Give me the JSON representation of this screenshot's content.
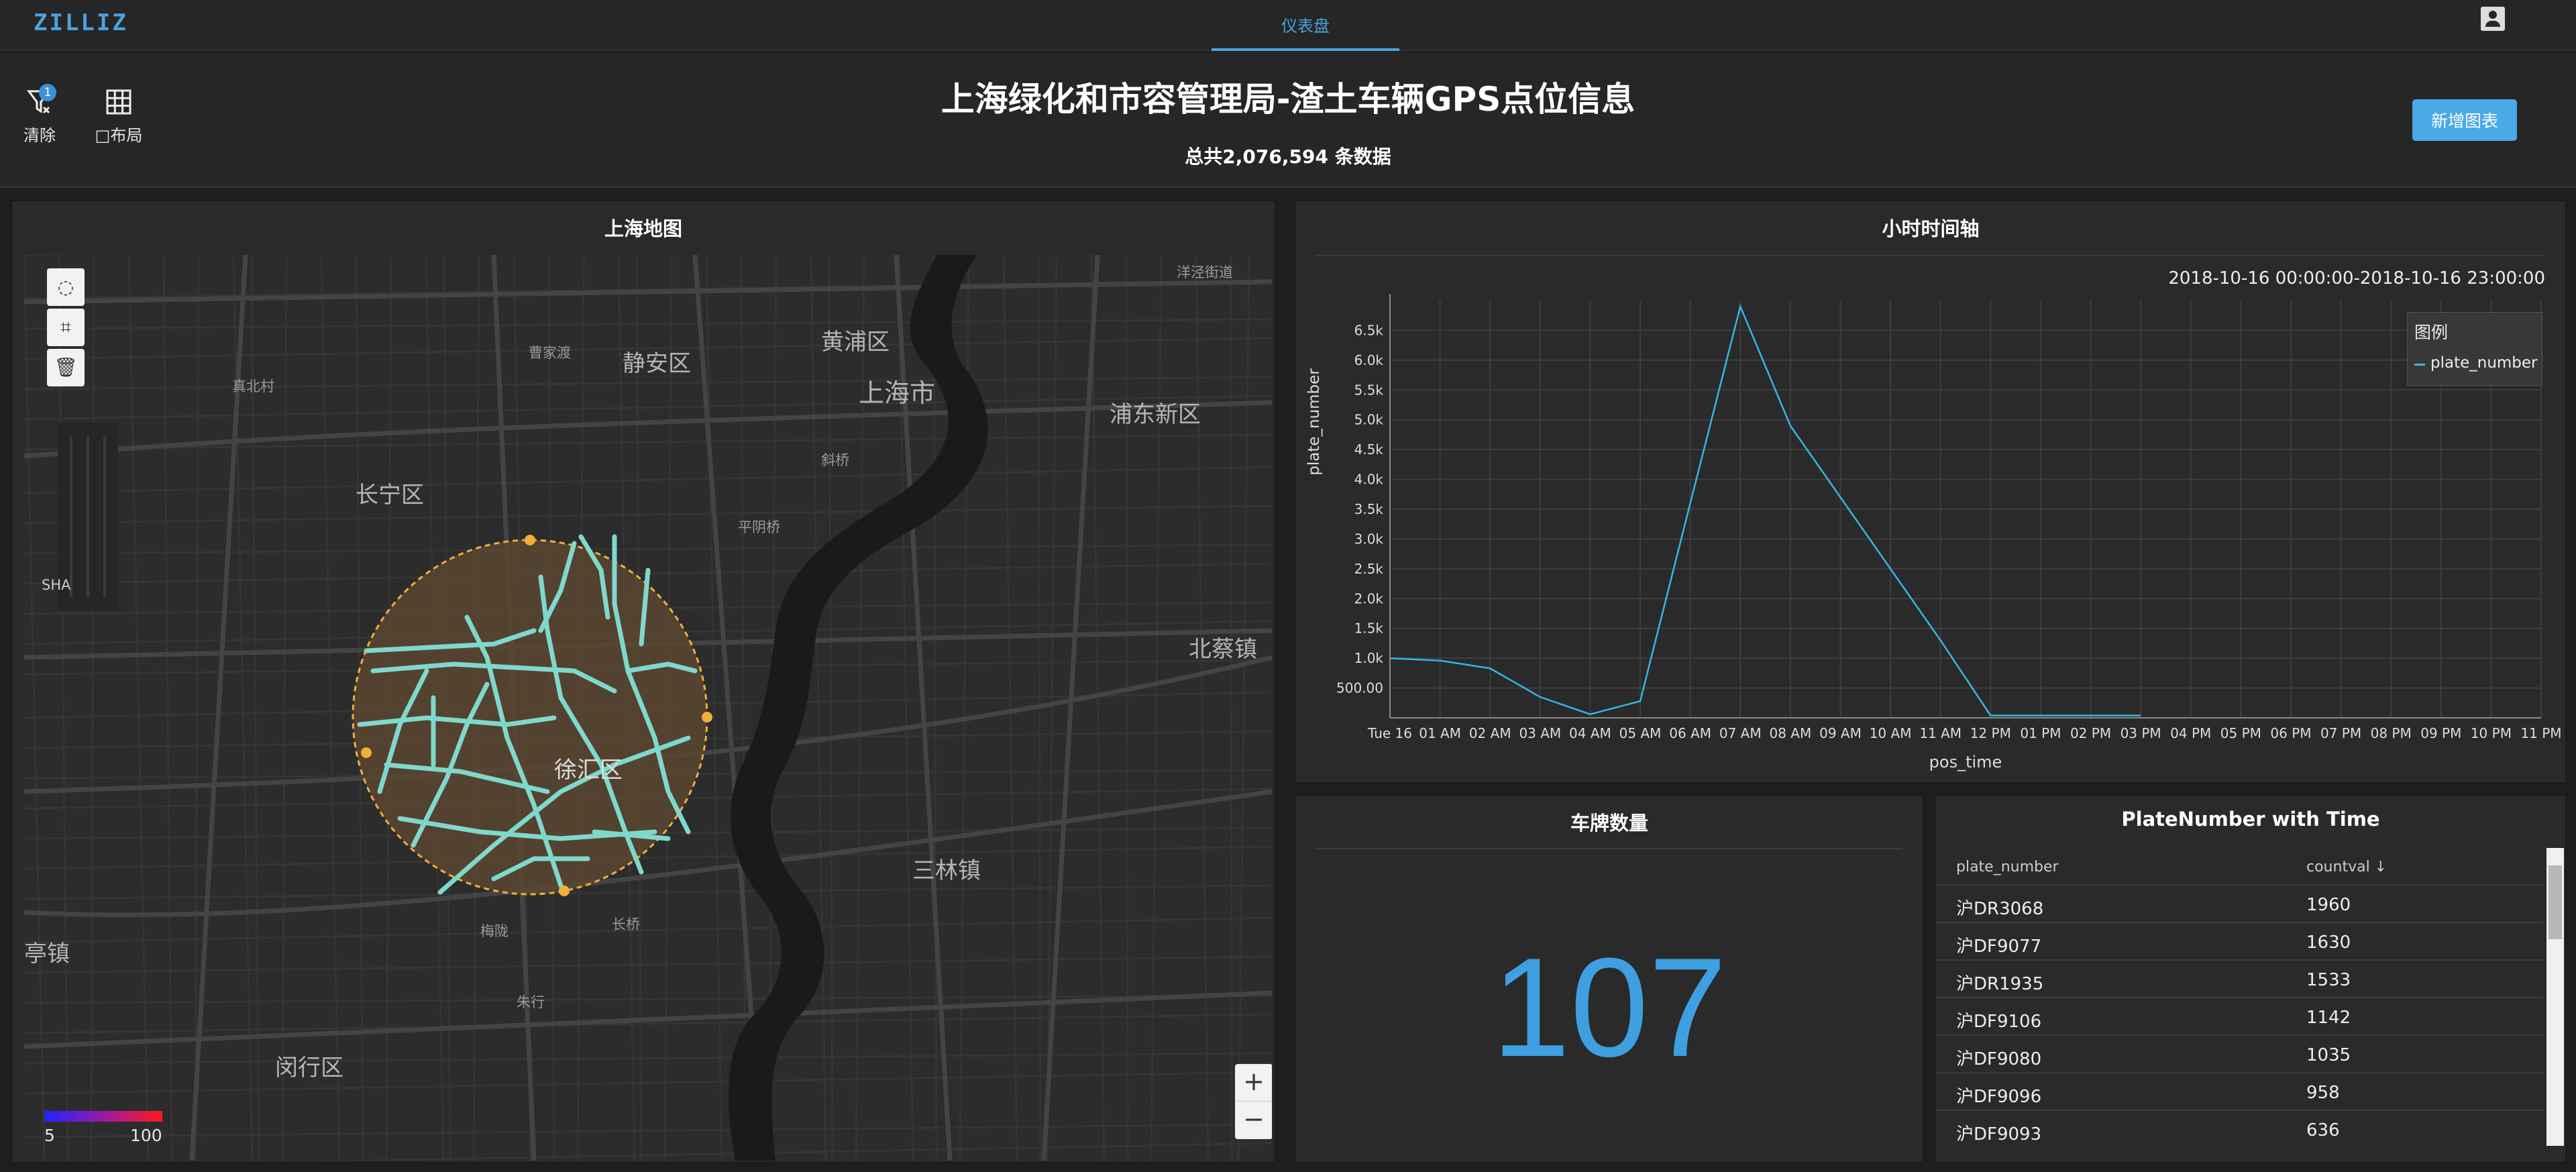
{
  "app": {
    "logo": "ZILLIZ",
    "nav_tab": "仪表盘"
  },
  "header": {
    "title": "上海绿化和市容管理局-渣土车辆GPS点位信息",
    "subtitle": "总共2,076,594 条数据",
    "clear_label": "清除",
    "clear_badge": "1",
    "layout_label": "□布局",
    "add_chart": "新增图表"
  },
  "map_panel": {
    "title": "上海地图",
    "labels": [
      "洋泾街道",
      "黄浦区",
      "静安区",
      "曹家渡",
      "真北村",
      "上海市",
      "浦东新区",
      "长宁区",
      "斜桥",
      "平阴桥",
      "SHA",
      "北蔡镇",
      "徐汇区",
      "三林镇",
      "梅陇",
      "长桥",
      "亭镇",
      "朱行",
      "闵行区"
    ],
    "legend_min": "5",
    "legend_max": "100",
    "zoom_in": "+",
    "zoom_out": "−",
    "colors": {
      "points": "#7fd8cc",
      "selection_fill": "#5a4630",
      "selection_stroke": "#f0b03c"
    }
  },
  "line_panel": {
    "title": "小时时间轴",
    "date_range": "2018-10-16 00:00:00-2018-10-16 23:00:00",
    "legend_title": "图例",
    "legend_item": "plate_number",
    "ylabel": "plate_number",
    "xlabel": "pos_time"
  },
  "chart_data": {
    "type": "line",
    "title": "小时时间轴",
    "xlabel": "pos_time",
    "ylabel": "plate_number",
    "x": [
      "Tue 16",
      "01 AM",
      "02 AM",
      "03 AM",
      "04 AM",
      "05 AM",
      "06 AM",
      "07 AM",
      "08 AM",
      "09 AM",
      "10 AM",
      "11 AM",
      "12 PM",
      "01 PM",
      "02 PM",
      "03 PM",
      "04 PM",
      "05 PM",
      "06 PM",
      "07 PM",
      "08 PM",
      "09 PM",
      "10 PM",
      "11 PM"
    ],
    "y_ticks": [
      "500.00",
      "1.0k",
      "1.5k",
      "2.0k",
      "2.5k",
      "3.0k",
      "3.5k",
      "4.0k",
      "4.5k",
      "5.0k",
      "5.5k",
      "6.0k",
      "6.5k"
    ],
    "ylim": [
      0,
      7000
    ],
    "series": [
      {
        "name": "plate_number",
        "color": "#35b6e4",
        "values": [
          1000,
          960,
          830,
          350,
          60,
          280,
          3600,
          6900,
          4900,
          3700,
          2500,
          1300,
          40,
          40,
          40,
          40
        ]
      }
    ],
    "grid": true,
    "legend": "top-right"
  },
  "count_panel": {
    "title": "车牌数量",
    "value": "107"
  },
  "table_panel": {
    "title": "PlateNumber with Time",
    "columns": [
      "plate_number",
      "countval ↓"
    ],
    "rows": [
      [
        "沪DR3068",
        "1960"
      ],
      [
        "沪DF9077",
        "1630"
      ],
      [
        "沪DR1935",
        "1533"
      ],
      [
        "沪DF9106",
        "1142"
      ],
      [
        "沪DF9080",
        "1035"
      ],
      [
        "沪DF9096",
        "958"
      ],
      [
        "沪DF9093",
        "636"
      ]
    ]
  }
}
